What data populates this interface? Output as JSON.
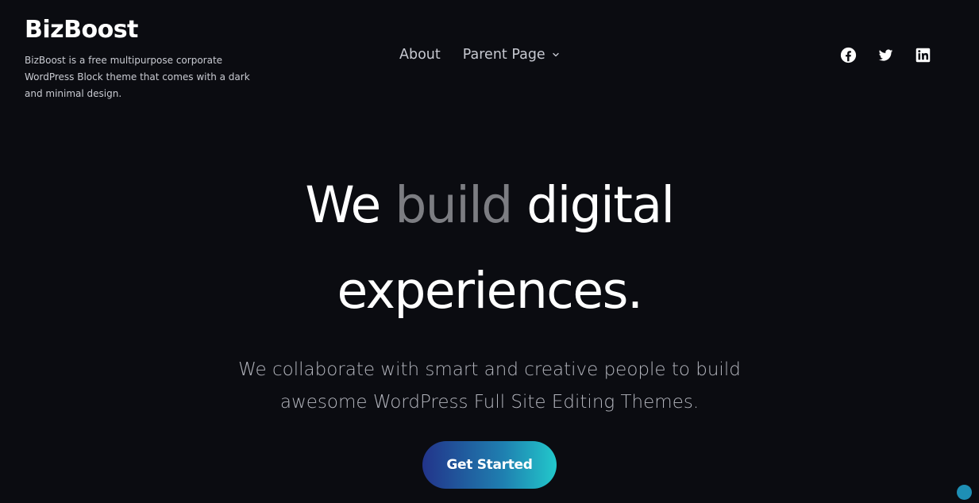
{
  "site": {
    "title": "BizBoost",
    "tagline": "BizBoost is a free multipurpose corporate WordPress Block theme that comes with a dark and minimal design."
  },
  "nav": {
    "items": [
      {
        "label": "About"
      },
      {
        "label": "Parent Page",
        "has_dropdown": true
      }
    ]
  },
  "social": {
    "icons": [
      "facebook-icon",
      "twitter-icon",
      "linkedin-icon"
    ]
  },
  "hero": {
    "heading_part1": "We ",
    "heading_highlight": "build",
    "heading_part2": " digital experiences.",
    "subtitle": "We collaborate with smart and creative people to build awesome WordPress Full Site Editing Themes.",
    "cta_label": "Get Started"
  },
  "colors": {
    "background": "#0b0c11",
    "muted_heading": "#7c7d82",
    "cta_gradient_start": "#22348a",
    "cta_gradient_end": "#22c8cb",
    "accent_dot": "#1e8fb5"
  }
}
